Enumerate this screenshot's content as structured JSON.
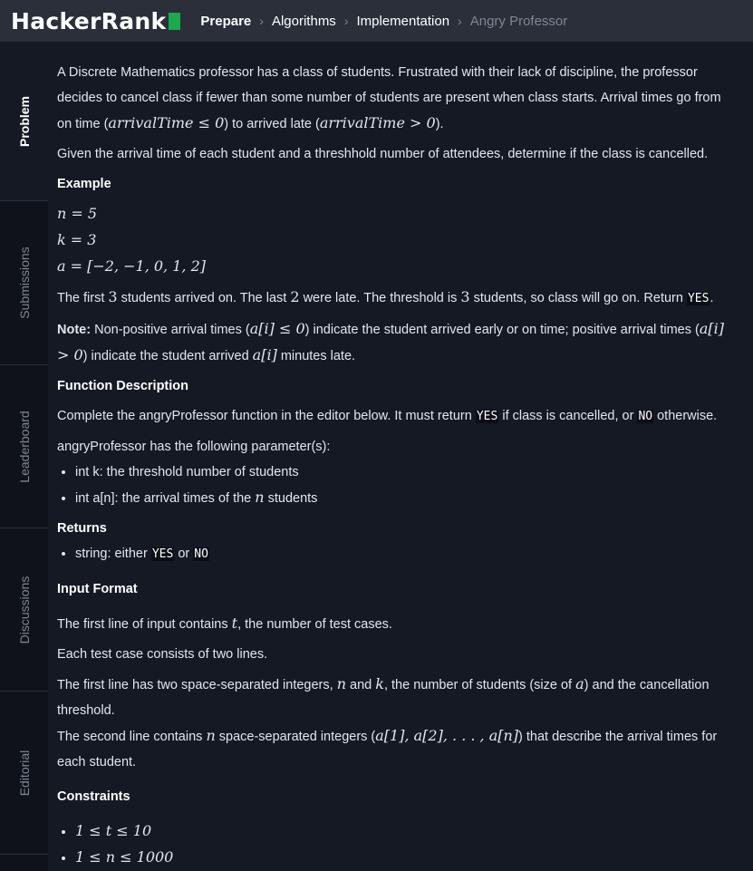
{
  "header": {
    "logo_text": "HackerRank",
    "breadcrumbs": [
      "Prepare",
      "Algorithms",
      "Implementation",
      "Angry Professor"
    ]
  },
  "sidebar": {
    "tabs": [
      "Problem",
      "Submissions",
      "Leaderboard",
      "Discussions",
      "Editorial"
    ]
  },
  "problem": {
    "intro_1": "A Discrete Mathematics professor has a class of students. Frustrated with their lack of discipline, the professor decides to cancel class if fewer than some number of students are present when class starts. Arrival times go from on time (",
    "intro_math_1": "arrivalTime ≤ 0",
    "intro_2": ") to arrived late (",
    "intro_math_2": "arrivalTime > 0",
    "intro_3": ").",
    "intro_para2": "Given the arrival time of each student and a threshhold number of attendees, determine if the class is cancelled.",
    "example_heading": "Example",
    "example_n": "n = 5",
    "example_k": "k = 3",
    "example_a": "a = [−2, −1, 0, 1, 2]",
    "example_text_1": "The first ",
    "example_text_3": "3",
    "example_text_2": " students arrived on. The last ",
    "example_text_2num": "2",
    "example_text_4": " were late. The threshold is ",
    "example_text_5": " students, so class will go on. Return ",
    "example_yes": "YES",
    "example_end": ".",
    "note_label": "Note:",
    "note_1": " Non-positive arrival times (",
    "note_m1": "a[i] ≤ 0",
    "note_2": ") indicate the student arrived early or on time; positive arrival times (",
    "note_m2": "a[i] > 0",
    "note_3": ") indicate the student arrived ",
    "note_m3": "a[i]",
    "note_4": " minutes late.",
    "func_heading": "Function Description",
    "func_1": "Complete the angryProfessor function in the editor below. It must return ",
    "func_yes": "YES",
    "func_2": " if class is cancelled, or ",
    "func_no": "NO",
    "func_3": " otherwise.",
    "params_intro": "angryProfessor has the following parameter(s):",
    "param_1": "int k: the threshold number of students",
    "param_2a": "int a[n]: the arrival times of the ",
    "param_2m": "n",
    "param_2b": " students",
    "returns_heading": "Returns",
    "returns_1": "string: either ",
    "returns_yes": "YES",
    "returns_or": " or ",
    "returns_no": "NO",
    "input_heading": "Input Format",
    "input_1a": "The first line of input contains ",
    "input_1m": "t",
    "input_1b": ", the number of test cases.",
    "input_2": "Each test case consists of two lines.",
    "input_3a": "The first line has two space-separated integers, ",
    "input_3m1": "n",
    "input_3b": " and ",
    "input_3m2": "k",
    "input_3c": ", the number of students (size of ",
    "input_3m3": "a",
    "input_3d": ") and the cancellation threshold.",
    "input_4a": "The second line contains ",
    "input_4m1": "n",
    "input_4b": " space-separated integers (",
    "input_4m2": "a[1], a[2], . . . , a[n]",
    "input_4c": ") that describe the arrival times for each student.",
    "constraints_heading": "Constraints",
    "constraint_1": "1 ≤ t ≤ 10",
    "constraint_2": "1 ≤ n ≤ 1000"
  }
}
